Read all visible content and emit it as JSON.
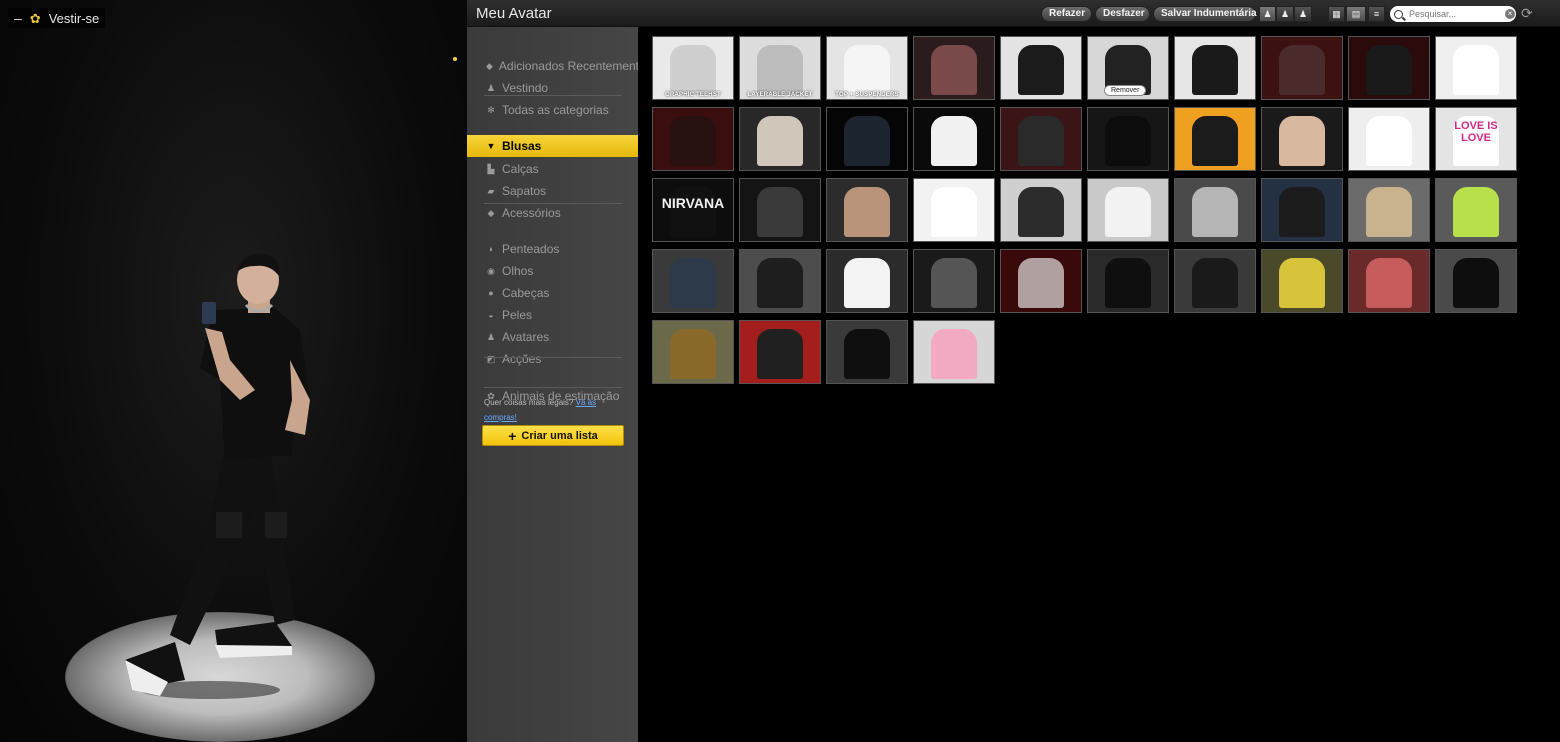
{
  "stage": {
    "title": "Vestir-se",
    "minus": "–",
    "flower": "✿"
  },
  "topbar": {
    "title": "Meu Avatar",
    "redo_label": "Refazer",
    "undo_label": "Desfazer",
    "save_label": "Salvar Indumentária",
    "search_placeholder": "Pesquisar...",
    "refresh_icon": "⟳"
  },
  "sidebar": {
    "items": [
      {
        "label": "Adicionados Recentemente",
        "icon": "tag-icon",
        "glyph": "◆",
        "active": false
      },
      {
        "label": "Vestindo",
        "icon": "person-icon",
        "glyph": "♟",
        "active": false
      },
      {
        "label": "Todas as categorias",
        "icon": "asterisk-icon",
        "glyph": "✻",
        "active": false
      },
      {
        "label": "Blusas",
        "icon": "shirt-icon",
        "glyph": "▼",
        "active": true
      },
      {
        "label": "Calças",
        "icon": "pants-icon",
        "glyph": "▙",
        "active": false
      },
      {
        "label": "Sapatos",
        "icon": "shoe-icon",
        "glyph": "▰",
        "active": false
      },
      {
        "label": "Acessórios",
        "icon": "gem-icon",
        "glyph": "◆",
        "active": false
      },
      {
        "label": "Penteados",
        "icon": "hair-icon",
        "glyph": "◗",
        "active": false
      },
      {
        "label": "Olhos",
        "icon": "eye-icon",
        "glyph": "◉",
        "active": false
      },
      {
        "label": "Cabeças",
        "icon": "head-icon",
        "glyph": "●",
        "active": false
      },
      {
        "label": "Peles",
        "icon": "lips-icon",
        "glyph": "◒",
        "active": false
      },
      {
        "label": "Avatares",
        "icon": "avatar-icon",
        "glyph": "♟",
        "active": false
      },
      {
        "label": "Acções",
        "icon": "action-icon",
        "glyph": "◩",
        "active": false
      },
      {
        "label": "Animais de estimação",
        "icon": "paw-icon",
        "glyph": "✿",
        "active": false
      }
    ],
    "promo_text": "Quer coisas mais legais?",
    "promo_link": "Vá às compras!",
    "create_list_label": "Criar uma lista",
    "create_plus": "+"
  },
  "grid": {
    "items": [
      {
        "label": "GRAPHIC TEEHST",
        "overlay": "",
        "bg": "#e9e9e9",
        "fg": "#cfcfcf"
      },
      {
        "label": "LAYERABLE JACKET",
        "overlay": "",
        "bg": "#dcdcdc",
        "fg": "#bdbdbd"
      },
      {
        "label": "TOP + SUSPENDERS",
        "overlay": "",
        "bg": "#e4e4e4",
        "fg": "#f5f5f5"
      },
      {
        "label": "",
        "overlay": "",
        "bg": "#2a1c1c",
        "fg": "#7a4a4a"
      },
      {
        "label": "",
        "overlay": "",
        "bg": "#e3e3e3",
        "fg": "#1b1b1b"
      },
      {
        "label": "",
        "overlay": "",
        "bg": "#d7d7d7",
        "fg": "#222",
        "remove": "Remover"
      },
      {
        "label": "",
        "overlay": "",
        "bg": "#e6e6e6",
        "fg": "#1a1a1a"
      },
      {
        "label": "",
        "overlay": "",
        "bg": "#3b1111",
        "fg": "#4a2a2a"
      },
      {
        "label": "",
        "overlay": "",
        "bg": "#2a0a0a",
        "fg": "#1a1a1a"
      },
      {
        "label": "",
        "overlay": "",
        "bg": "#efefef",
        "fg": "#ffffff"
      },
      {
        "label": "",
        "overlay": "",
        "bg": "#3a0e0e",
        "fg": "#261010"
      },
      {
        "label": "",
        "overlay": "",
        "bg": "#282828",
        "fg": "#cfc7b9"
      },
      {
        "label": "",
        "overlay": "",
        "bg": "#050505",
        "fg": "#1c2430"
      },
      {
        "label": "",
        "overlay": "",
        "bg": "#0a0a0a",
        "fg": "#f1f1f1"
      },
      {
        "label": "",
        "overlay": "",
        "bg": "#3b1515",
        "fg": "#2a2a2a"
      },
      {
        "label": "",
        "overlay": "",
        "bg": "#161616",
        "fg": "#0c0c0c"
      },
      {
        "label": "",
        "overlay": "",
        "bg": "#f0a020",
        "fg": "#1b1b1b"
      },
      {
        "label": "",
        "overlay": "",
        "bg": "#1a1a1a",
        "fg": "#d9b8a0"
      },
      {
        "label": "",
        "overlay": "",
        "bg": "#eeeeee",
        "fg": "#ffffff"
      },
      {
        "label": "",
        "overlay": "LOVE IS LOVE",
        "bg": "#e4e4e4",
        "fg": "#ffffff"
      },
      {
        "label": "",
        "overlay": "NIRVANA",
        "bg": "#0d0d0d",
        "fg": "#111"
      },
      {
        "label": "",
        "overlay": "",
        "bg": "#141414",
        "fg": "#3a3a3a"
      },
      {
        "label": "",
        "overlay": "",
        "bg": "#2c2c2c",
        "fg": "#b9937a"
      },
      {
        "label": "",
        "overlay": "",
        "bg": "#f2f2f2",
        "fg": "#ffffff"
      },
      {
        "label": "",
        "overlay": "",
        "bg": "#cfcfcf",
        "fg": "#2c2c2c"
      },
      {
        "label": "",
        "overlay": "",
        "bg": "#c9c9c9",
        "fg": "#f2f2f2"
      },
      {
        "label": "",
        "overlay": "",
        "bg": "#4a4a4a",
        "fg": "#b5b5b5"
      },
      {
        "label": "",
        "overlay": "",
        "bg": "#243142",
        "fg": "#1c1c1c"
      },
      {
        "label": "",
        "overlay": "",
        "bg": "#6b6b6b",
        "fg": "#c9b28e"
      },
      {
        "label": "",
        "overlay": "",
        "bg": "#5a5a5a",
        "fg": "#b7e04a"
      },
      {
        "label": "",
        "overlay": "",
        "bg": "#3a3a3a",
        "fg": "#2c3a4a"
      },
      {
        "label": "",
        "overlay": "",
        "bg": "#4d4d4d",
        "fg": "#1e1e1e"
      },
      {
        "label": "",
        "overlay": "",
        "bg": "#2b2b2b",
        "fg": "#f3f3f3"
      },
      {
        "label": "",
        "overlay": "",
        "bg": "#1a1a1a",
        "fg": "#555"
      },
      {
        "label": "",
        "overlay": "",
        "bg": "#3a0a0a",
        "fg": "#b0a0a0"
      },
      {
        "label": "",
        "overlay": "",
        "bg": "#2a2a2a",
        "fg": "#0f0f0f"
      },
      {
        "label": "",
        "overlay": "",
        "bg": "#3a3a3a",
        "fg": "#1a1a1a"
      },
      {
        "label": "",
        "overlay": "",
        "bg": "#4a4a2a",
        "fg": "#d8c43a"
      },
      {
        "label": "",
        "overlay": "",
        "bg": "#6a2a2a",
        "fg": "#c75c5c"
      },
      {
        "label": "",
        "overlay": "",
        "bg": "#4a4a4a",
        "fg": "#0e0e0e"
      },
      {
        "label": "",
        "overlay": "",
        "bg": "#6a6a4a",
        "fg": "#8a6a2a"
      },
      {
        "label": "",
        "overlay": "",
        "bg": "#a51e1e",
        "fg": "#202020"
      },
      {
        "label": "",
        "overlay": "",
        "bg": "#3a3a3a",
        "fg": "#0f0f0f"
      },
      {
        "label": "",
        "overlay": "",
        "bg": "#d6d6d6",
        "fg": "#f2a9c2"
      }
    ]
  },
  "colors": {
    "accent": "#f2c40a",
    "sidebar": "#404040"
  }
}
